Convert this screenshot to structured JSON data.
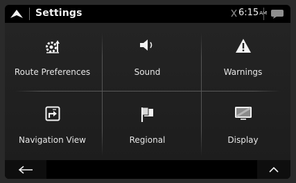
{
  "header": {
    "title": "Settings",
    "time": "6:15",
    "time_suffix": "AM"
  },
  "menu": {
    "route_preferences": "Route Preferences",
    "sound": "Sound",
    "warnings": "Warnings",
    "navigation_view": "Navigation View",
    "regional": "Regional",
    "display": "Display"
  },
  "icons": {
    "home": "navigation-arrow-icon",
    "gps": "no-gps-signal-icon",
    "message": "message-bubble-icon",
    "back": "back-arrow-icon",
    "up": "chevron-up-icon"
  },
  "colors": {
    "background": "#1a1a1a",
    "bars": "#000000",
    "text": "#e8e8e8"
  }
}
